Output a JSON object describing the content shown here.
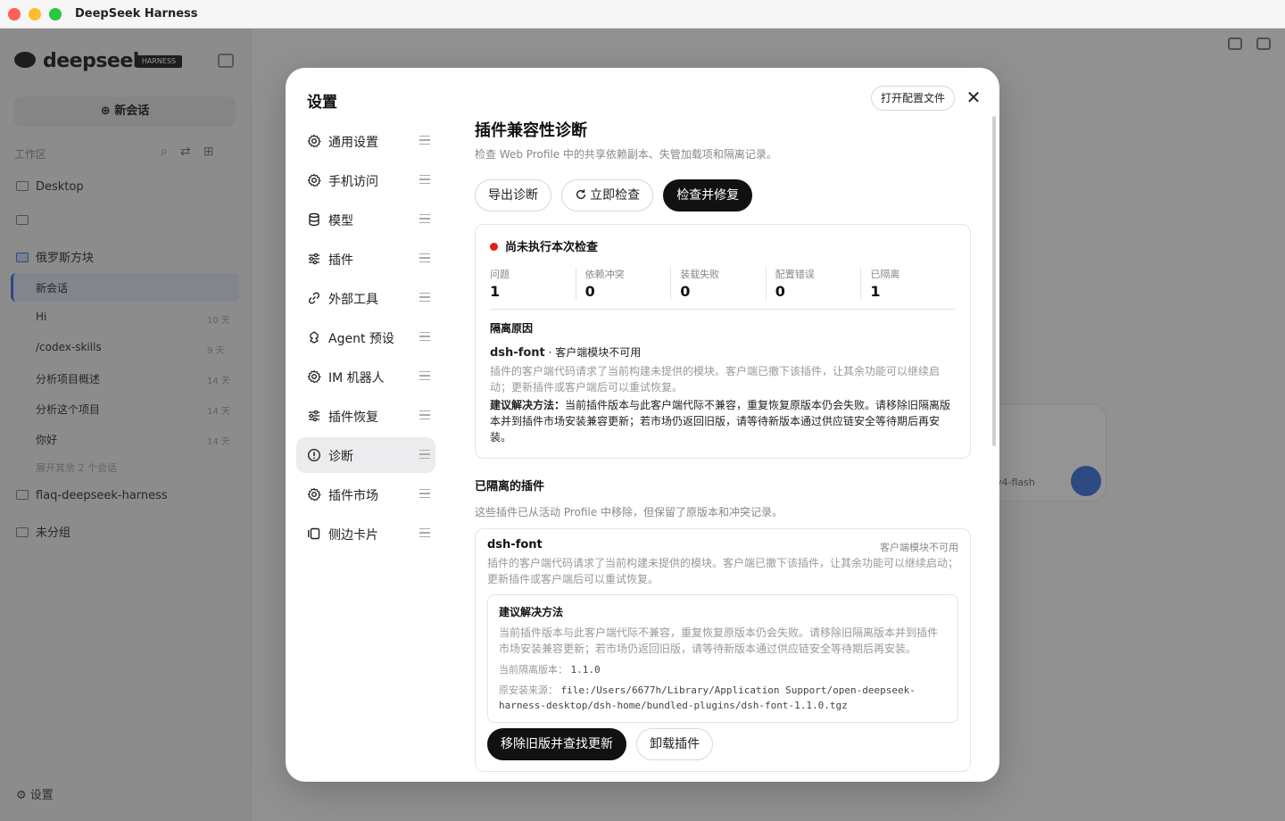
{
  "window": {
    "title": "DeepSeek Harness"
  },
  "app": {
    "logo_text": "deepseek",
    "logo_badge": "HARNESS",
    "new_chat": "新会话",
    "workspace_label": "工作区",
    "tree": [
      {
        "label": "Desktop"
      },
      {
        "label": ""
      },
      {
        "label": "俄罗斯方块"
      }
    ],
    "sessions": [
      {
        "label": "新会话",
        "time": ""
      },
      {
        "label": "Hi",
        "time": "10 天"
      },
      {
        "label": "/codex-skills",
        "time": "9 天"
      },
      {
        "label": "分析项目概述",
        "time": "14 天"
      },
      {
        "label": "分析这个项目",
        "time": "14 天"
      },
      {
        "label": "你好",
        "time": "14 天"
      }
    ],
    "more_sessions": "展开其余 2 个会话",
    "tree_after": [
      {
        "label": "flaq-deepseek-harness"
      },
      {
        "label": "未分组"
      }
    ],
    "settings_label": "设置",
    "chat_model": "v4-flash"
  },
  "modal": {
    "title": "设置",
    "open_config": "打开配置文件",
    "close": "✕",
    "nav": [
      {
        "label": "通用设置",
        "icon": "gear-icon"
      },
      {
        "label": "手机访问",
        "icon": "gear-icon"
      },
      {
        "label": "模型",
        "icon": "database-icon"
      },
      {
        "label": "插件",
        "icon": "sliders-icon"
      },
      {
        "label": "外部工具",
        "icon": "link-icon"
      },
      {
        "label": "Agent 预设",
        "icon": "agent-icon"
      },
      {
        "label": "IM 机器人",
        "icon": "gear-icon"
      },
      {
        "label": "插件恢复",
        "icon": "sliders-icon"
      },
      {
        "label": "诊断",
        "icon": "alert-circle-icon",
        "active": true
      },
      {
        "label": "插件市场",
        "icon": "gear-icon"
      },
      {
        "label": "侧边卡片",
        "icon": "panels-icon"
      }
    ]
  },
  "diagnosis": {
    "title": "插件兼容性诊断",
    "subtitle": "检查 Web Profile 中的共享依赖副本、失管加载项和隔离记录。",
    "buttons": {
      "export": "导出诊断",
      "check_now": "立即检查",
      "check_fix": "检查并修复"
    },
    "status": "尚未执行本次检查",
    "stats": [
      {
        "label": "问题",
        "value": "1"
      },
      {
        "label": "依赖冲突",
        "value": "0"
      },
      {
        "label": "装载失败",
        "value": "0"
      },
      {
        "label": "配置错误",
        "value": "0"
      },
      {
        "label": "已隔离",
        "value": "1"
      }
    ],
    "reason_heading": "隔离原因",
    "reason_plugin": "dsh-font",
    "reason_short": " · 客户端模块不可用",
    "reason_desc": "插件的客户端代码请求了当前构建未提供的模块。客户端已撤下该插件，让其余功能可以继续启动；更新插件或客户端后可以重试恢复。",
    "advice_label": "建议解决方法：",
    "advice_text": "当前插件版本与此客户端代际不兼容，重复恢复原版本仍会失败。请移除旧隔离版本并到插件市场安装兼容更新；若市场仍返回旧版，请等待新版本通过供应链安全等待期后再安装。"
  },
  "isolated": {
    "title": "已隔离的插件",
    "subtitle": "这些插件已从活动 Profile 中移除，但保留了原版本和冲突记录。",
    "plugin": {
      "name": "dsh-font",
      "tag": "客户端模块不可用",
      "desc": "插件的客户端代码请求了当前构建未提供的模块。客户端已撤下该插件，让其余功能可以继续启动；更新插件或客户端后可以重试恢复。",
      "advice_heading": "建议解决方法",
      "advice_text": "当前插件版本与此客户端代际不兼容，重复恢复原版本仍会失败。请移除旧隔离版本并到插件市场安装兼容更新；若市场仍返回旧版，请等待新版本通过供应链安全等待期后再安装。",
      "version_label": "当前隔离版本：",
      "version": "1.1.0",
      "source_label": "原安装来源：",
      "source": "file:/Users/6677h/Library/Application Support/open-deepseek-harness-desktop/dsh-home/bundled-plugins/dsh-font-1.1.0.tgz",
      "btn_remove": "移除旧版并查找更新",
      "btn_uninstall": "卸载插件"
    }
  }
}
